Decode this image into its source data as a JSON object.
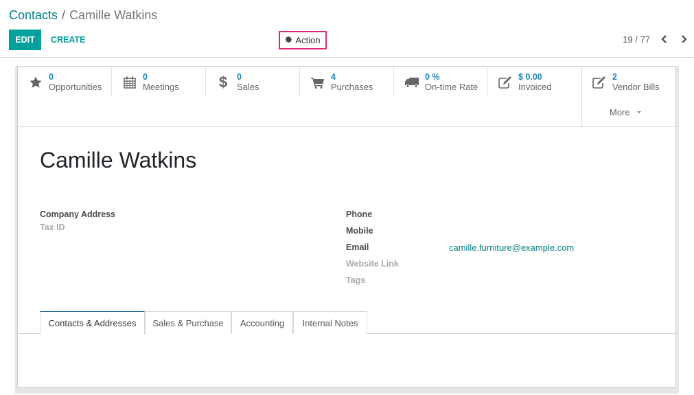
{
  "breadcrumb": {
    "parent": "Contacts",
    "separator": "/",
    "current": "Camille Watkins"
  },
  "toolbar": {
    "edit_label": "EDIT",
    "create_label": "CREATE",
    "action_label": "Action"
  },
  "pager": {
    "value": "19 / 77"
  },
  "stat_buttons": [
    {
      "icon": "star-icon",
      "value": "0",
      "label": "Opportunities"
    },
    {
      "icon": "calendar-icon",
      "value": "0",
      "label": "Meetings"
    },
    {
      "icon": "dollar-icon",
      "value": "0",
      "label": "Sales"
    },
    {
      "icon": "shopping-cart-icon",
      "value": "4",
      "label": "Purchases"
    },
    {
      "icon": "truck-icon",
      "value": "0 %",
      "label": "On-time Rate"
    },
    {
      "icon": "edit-icon",
      "value": "$ 0.00",
      "label": "Invoiced"
    },
    {
      "icon": "edit-icon",
      "value": "2",
      "label": "Vendor Bills"
    }
  ],
  "more_label": "More",
  "record": {
    "name": "Camille Watkins",
    "left_fields": [
      {
        "label": "Company Address",
        "muted": false
      },
      {
        "label": "Tax ID",
        "muted": true
      }
    ],
    "right_fields": [
      {
        "label": "Phone",
        "value": "",
        "muted": false
      },
      {
        "label": "Mobile",
        "value": "",
        "muted": false
      },
      {
        "label": "Email",
        "value": "camille.furniture@example.com",
        "muted": false
      },
      {
        "label": "Website Link",
        "value": "",
        "muted": true
      },
      {
        "label": "Tags",
        "value": "",
        "muted": true
      }
    ]
  },
  "tabs": [
    {
      "label": "Contacts & Addresses",
      "active": true
    },
    {
      "label": "Sales & Purchase",
      "active": false
    },
    {
      "label": "Accounting",
      "active": false
    },
    {
      "label": "Internal Notes",
      "active": false
    }
  ],
  "colors": {
    "primary": "#00a09d",
    "link": "#017e84",
    "stat_value": "#1f83b8",
    "highlight": "#e0287a"
  }
}
